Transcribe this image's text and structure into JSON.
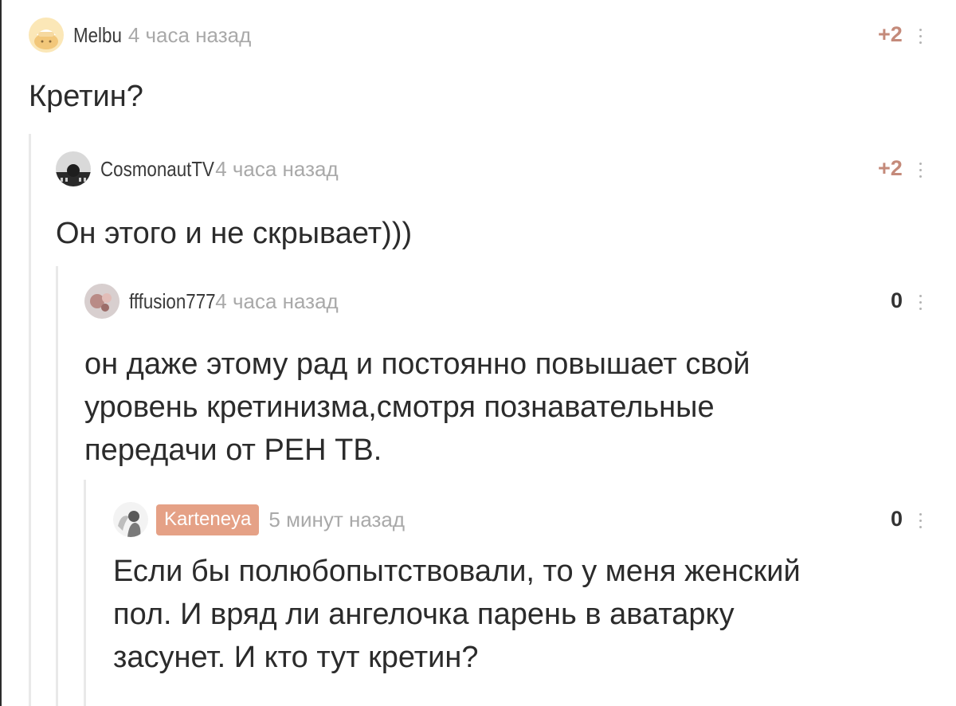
{
  "comments": [
    {
      "author": "Melbu",
      "time": "4 часа назад",
      "rating": "+2",
      "text": "Кретин?",
      "avatar_icon": "cat-avatar-icon"
    },
    {
      "author": "CosmonautTV",
      "time": "4 часа назад",
      "rating": "+2",
      "text": "Он этого и не скрывает)))",
      "avatar_icon": "dark-photo-avatar-icon"
    },
    {
      "author": "fffusion777",
      "time": "4 часа назад",
      "rating": "0",
      "text": "он даже этому рад и постоянно повышает свой\nуровень кретинизма,смотря познавательные\nпередачи от РЕН ТВ.",
      "avatar_icon": "photo-avatar-icon"
    },
    {
      "author": "Karteneya",
      "time": "5 минут назад",
      "rating": "0",
      "text": "Если бы полюбопытствовали, то у меня женский\nпол. И вряд ли ангелочка парень в аватарку\nзасунет. И кто тут кретин?",
      "avatar_icon": "angel-avatar-icon",
      "author_highlighted": true
    }
  ],
  "colors": {
    "rating_positive": "#c48a7a",
    "author_badge": "#e5a186",
    "time": "#a9a9a9",
    "thread_line": "#e9e9e9"
  }
}
